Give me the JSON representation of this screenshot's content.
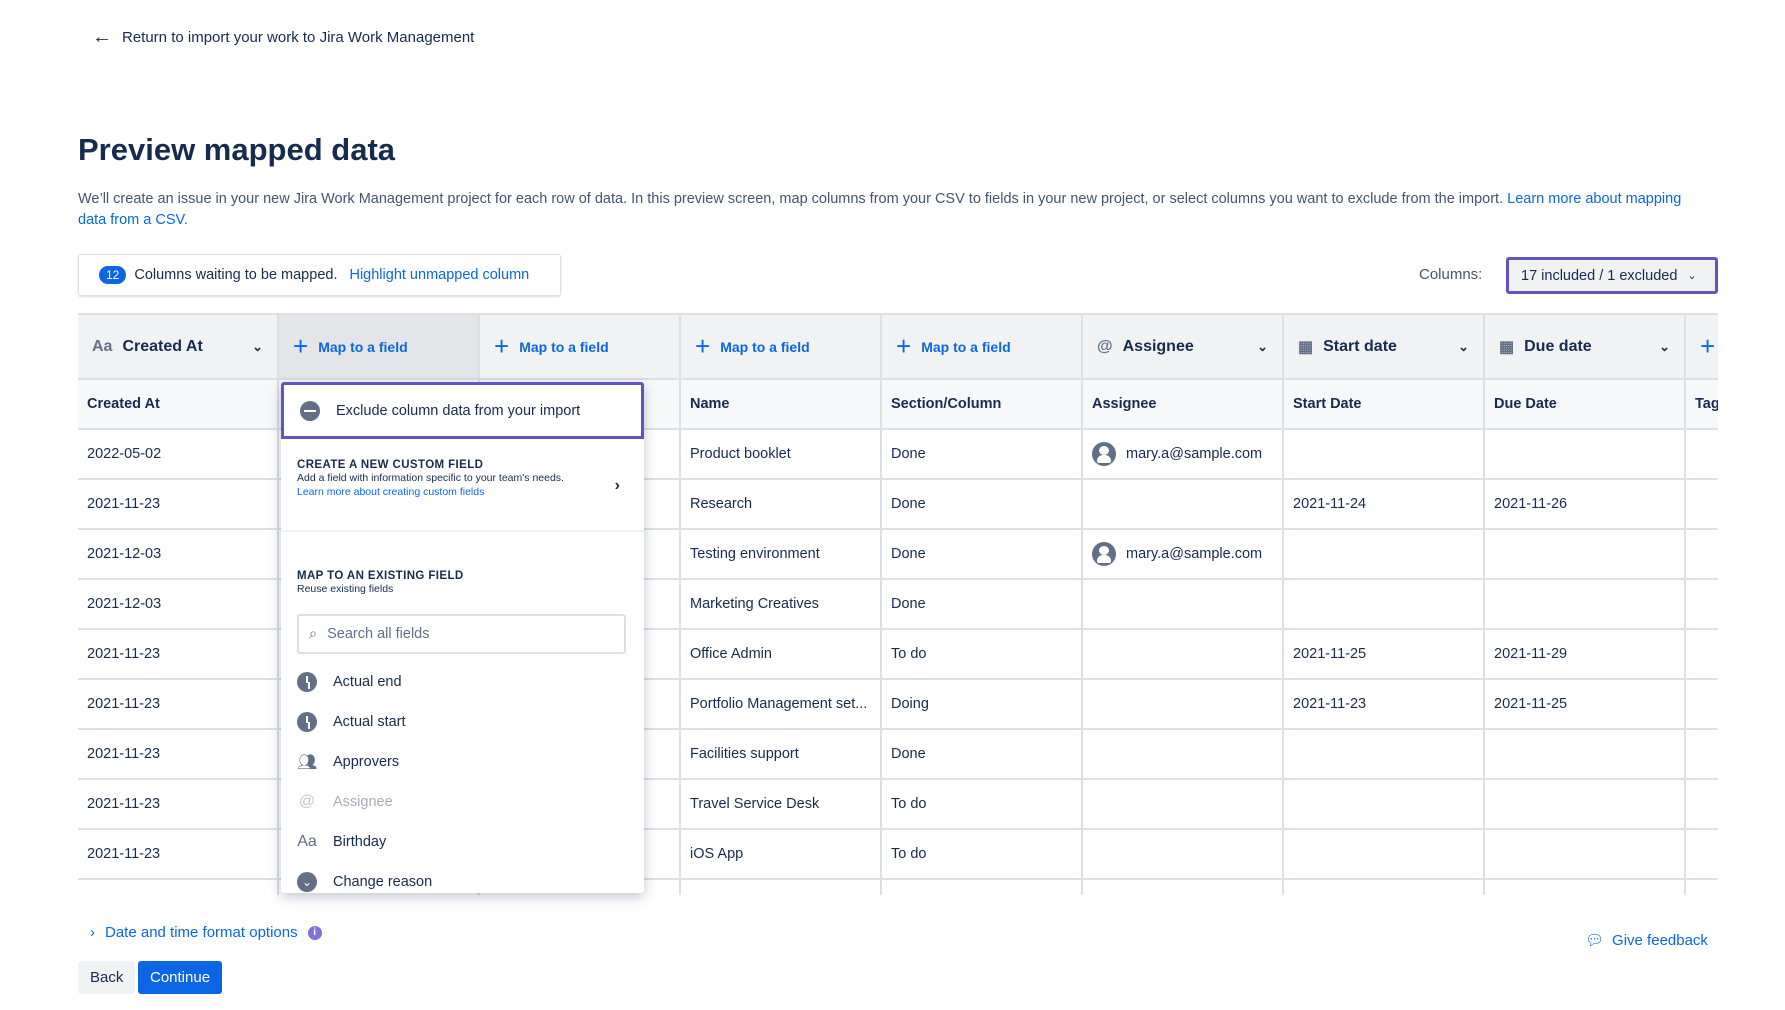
{
  "nav": {
    "back_link": "Return to import your work to Jira Work Management"
  },
  "page": {
    "title": "Preview mapped data",
    "description": "We’ll create an issue in your new Jira Work Management project for each row of data. In this preview screen, map columns from your CSV to fields in your new project, or select columns you want to exclude from the import.",
    "learn_more_link": "Learn more about mapping data from a CSV."
  },
  "banner": {
    "count": "12",
    "text": "Columns waiting to be mapped.",
    "link": "Highlight unmapped column"
  },
  "columns_control": {
    "label": "Columns:",
    "value": "17 included / 1 excluded"
  },
  "table": {
    "mapped_headers": [
      {
        "label": "Created At",
        "icon": "text-icon",
        "type": "mapped"
      },
      {
        "label": "Map to a field",
        "type": "map",
        "active": true
      },
      {
        "label": "Map to a field",
        "type": "map"
      },
      {
        "label": "Map to a field",
        "type": "map"
      },
      {
        "label": "Map to a field",
        "type": "map"
      },
      {
        "label": "Assignee",
        "icon": "at-icon",
        "type": "mapped"
      },
      {
        "label": "Start date",
        "icon": "calendar-icon",
        "type": "mapped"
      },
      {
        "label": "Due date",
        "icon": "calendar-icon",
        "type": "mapped"
      },
      {
        "label": "",
        "type": "add"
      }
    ],
    "csv_headers": [
      "Created At",
      "",
      "",
      "Name",
      "Section/Column",
      "Assignee",
      "Start Date",
      "Due Date",
      "Tag"
    ],
    "rows": [
      [
        "2022-05-02",
        "",
        "",
        "Product booklet",
        "Done",
        "mary.a@sample.com",
        "",
        "",
        ""
      ],
      [
        "2021-11-23",
        "",
        "",
        "Research",
        "Done",
        "",
        "2021-11-24",
        "2021-11-26",
        ""
      ],
      [
        "2021-12-03",
        "",
        "",
        "Testing environment",
        "Done",
        "mary.a@sample.com",
        "",
        "",
        ""
      ],
      [
        "2021-12-03",
        "",
        "",
        "Marketing Creatives",
        "Done",
        "",
        "",
        "",
        ""
      ],
      [
        "2021-11-23",
        "",
        "",
        "Office Admin",
        "To do",
        "",
        "2021-11-25",
        "2021-11-29",
        ""
      ],
      [
        "2021-11-23",
        "",
        "",
        "Portfolio Management set...",
        "Doing",
        "",
        "2021-11-23",
        "2021-11-25",
        ""
      ],
      [
        "2021-11-23",
        "",
        "",
        "Facilities support",
        "Done",
        "",
        "",
        "",
        ""
      ],
      [
        "2021-11-23",
        "",
        "",
        "Travel Service Desk",
        "To do",
        "",
        "",
        "",
        ""
      ],
      [
        "2021-11-23",
        "",
        "",
        "iOS App",
        "To do",
        "",
        "",
        "",
        ""
      ],
      [
        "",
        "",
        "",
        "",
        "",
        "",
        "",
        "",
        ""
      ]
    ]
  },
  "popup": {
    "exclude": "Exclude column data from your import",
    "custom_title": "CREATE A NEW CUSTOM FIELD",
    "custom_desc": "Add a field with information specific to your team's needs.",
    "custom_link": "Learn more about creating custom fields",
    "existing_title": "MAP TO AN EXISTING FIELD",
    "existing_desc": "Reuse existing fields",
    "search_placeholder": "Search all fields",
    "items": [
      {
        "label": "Actual end",
        "icon": "clock-icon"
      },
      {
        "label": "Actual start",
        "icon": "clock-icon"
      },
      {
        "label": "Approvers",
        "icon": "people-icon"
      },
      {
        "label": "Assignee",
        "icon": "at-icon",
        "disabled": true
      },
      {
        "label": "Birthday",
        "icon": "text-icon"
      },
      {
        "label": "Change reason",
        "icon": "chevron-circle-icon"
      }
    ]
  },
  "footer": {
    "date_options": "Date and time format options",
    "back": "Back",
    "continue": "Continue",
    "feedback": "Give feedback"
  },
  "colors": {
    "accent": "#0c66e4",
    "focus": "#6554c0"
  }
}
